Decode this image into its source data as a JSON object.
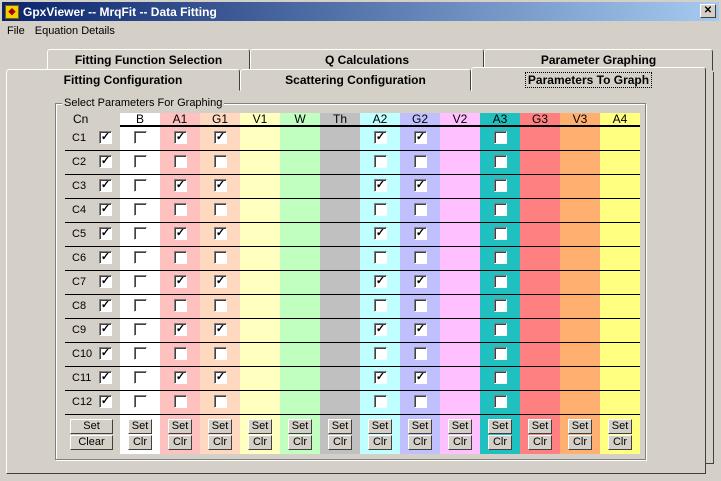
{
  "window": {
    "title": "GpxViewer -- MrqFit -- Data Fitting",
    "close": "✕"
  },
  "menu": [
    "File",
    "Equation Details"
  ],
  "tabs_row1": [
    "Fitting Function Selection",
    "Q  Calculations",
    "Parameter Graphing"
  ],
  "tabs_row2": [
    "Fitting Configuration",
    "Scattering Configuration",
    "Parameters To Graph"
  ],
  "group_label": "Select Parameters For Graphing",
  "cn_header": "Cn",
  "row_labels": [
    "C1",
    "C2",
    "C3",
    "C4",
    "C5",
    "C6",
    "C7",
    "C8",
    "C9",
    "C10",
    "C11",
    "C12"
  ],
  "cn_checked": [
    true,
    true,
    true,
    true,
    true,
    true,
    true,
    true,
    true,
    true,
    true,
    true
  ],
  "columns": [
    {
      "name": "B",
      "color": "#ffffff",
      "checkbox": true,
      "checked": [
        false,
        false,
        false,
        false,
        false,
        false,
        false,
        false,
        false,
        false,
        false,
        false
      ],
      "set": "Set",
      "clr": "Clr"
    },
    {
      "name": "A1",
      "color": "#ffc0c0",
      "checkbox": true,
      "checked": [
        true,
        false,
        true,
        false,
        true,
        false,
        true,
        false,
        true,
        false,
        true,
        false
      ],
      "set": "Set",
      "clr": "Clr"
    },
    {
      "name": "G1",
      "color": "#ffd8c0",
      "checkbox": true,
      "checked": [
        true,
        false,
        true,
        false,
        true,
        false,
        true,
        false,
        true,
        false,
        true,
        false
      ],
      "set": "Set",
      "clr": "Clr"
    },
    {
      "name": "V1",
      "color": "#ffffc0",
      "checkbox": false,
      "set": "Set",
      "clr": "Clr"
    },
    {
      "name": "W",
      "color": "#c0ffc0",
      "checkbox": false,
      "set": "Set",
      "clr": "Clr"
    },
    {
      "name": "Th",
      "color": "#c0c0c0",
      "checkbox": false,
      "set": "Set",
      "clr": "Clr"
    },
    {
      "name": "A2",
      "color": "#c0ffff",
      "checkbox": true,
      "checked": [
        true,
        false,
        true,
        false,
        true,
        false,
        true,
        false,
        true,
        false,
        true,
        false
      ],
      "set": "Set",
      "clr": "Clr"
    },
    {
      "name": "G2",
      "color": "#c0c0ff",
      "checkbox": true,
      "checked": [
        true,
        false,
        true,
        false,
        true,
        false,
        true,
        false,
        true,
        false,
        true,
        false
      ],
      "set": "Set",
      "clr": "Clr"
    },
    {
      "name": "V2",
      "color": "#ffc0ff",
      "checkbox": false,
      "set": "Set",
      "clr": "Clr"
    },
    {
      "name": "A3",
      "color": "#20c0c0",
      "checkbox": true,
      "checked": [
        false,
        false,
        false,
        false,
        false,
        false,
        false,
        false,
        false,
        false,
        false,
        false
      ],
      "set": "Set",
      "clr": "Clr"
    },
    {
      "name": "G3",
      "color": "#ff8080",
      "checkbox": false,
      "set": "Set",
      "clr": "Clr"
    },
    {
      "name": "V3",
      "color": "#ffb070",
      "checkbox": false,
      "set": "Set",
      "clr": "Clr"
    },
    {
      "name": "A4",
      "color": "#ffff80",
      "checkbox": false,
      "set": "Set",
      "clr": "Clr"
    }
  ],
  "cn_buttons": {
    "set": "Set",
    "clear": "Clear"
  }
}
